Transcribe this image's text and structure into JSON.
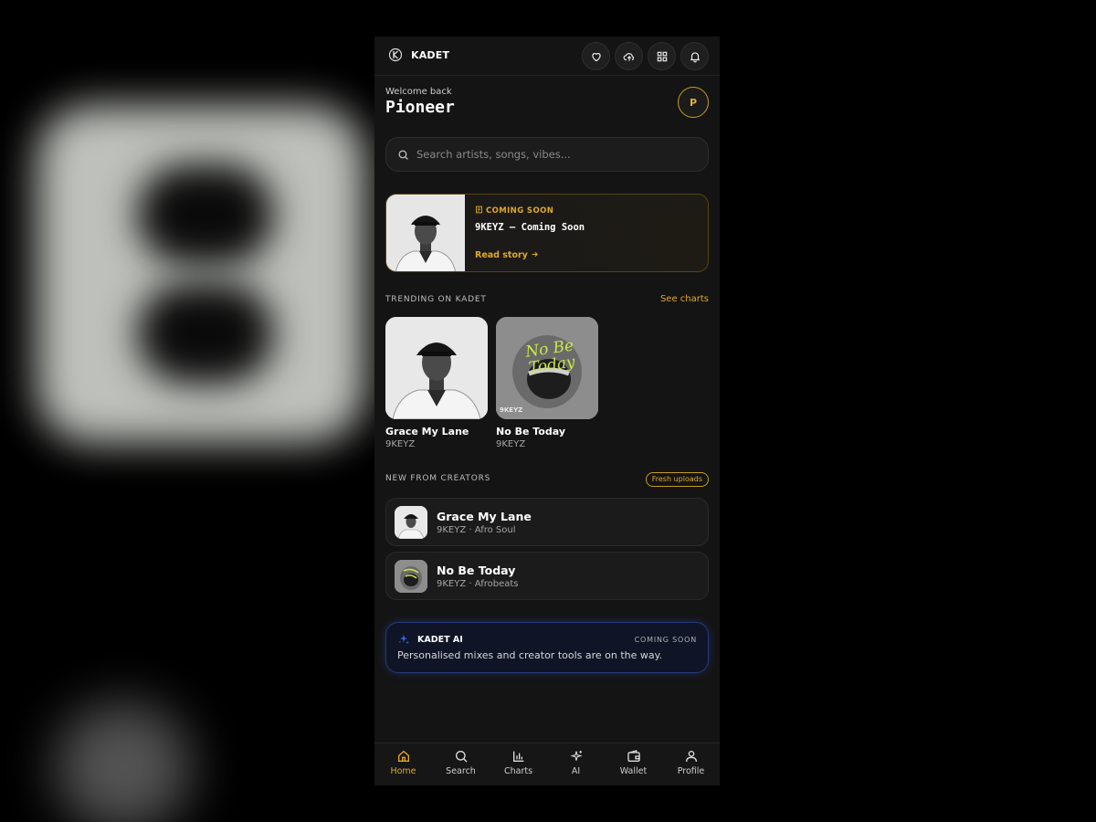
{
  "app": {
    "brand": "KADET"
  },
  "header": {
    "welcome": "Welcome back",
    "username": "Pioneer",
    "avatar_initial": "P"
  },
  "search": {
    "placeholder": "Search artists, songs, vibes..."
  },
  "promo": {
    "tag": "COMING SOON",
    "title": "9KEYZ — Coming Soon",
    "link": "Read story"
  },
  "trending": {
    "title": "TRENDING ON KADET",
    "link": "See charts",
    "items": [
      {
        "title": "Grace My Lane",
        "artist": "9KEYZ"
      },
      {
        "title": "No Be Today",
        "artist": "9KEYZ",
        "art_text": "No Be Today",
        "art_label": "9KEYZ"
      }
    ]
  },
  "creators": {
    "title": "NEW FROM CREATORS",
    "chip": "Fresh uploads",
    "items": [
      {
        "title": "Grace My Lane",
        "meta": "9KEYZ · Afro Soul"
      },
      {
        "title": "No Be Today",
        "meta": "9KEYZ · Afrobeats"
      }
    ]
  },
  "ai": {
    "label": "KADET AI",
    "status": "COMING SOON",
    "description": "Personalised mixes and creator tools are on the way."
  },
  "nav": {
    "items": [
      {
        "label": "Home",
        "icon": "home-icon",
        "active": true
      },
      {
        "label": "Search",
        "icon": "search-icon"
      },
      {
        "label": "Charts",
        "icon": "bar-chart-icon"
      },
      {
        "label": "AI",
        "icon": "sparkles-icon"
      },
      {
        "label": "Wallet",
        "icon": "wallet-icon"
      },
      {
        "label": "Profile",
        "icon": "user-icon"
      }
    ]
  },
  "colors": {
    "accent": "#e0a92a",
    "background": "#141414",
    "ai_accent": "#263a7a"
  }
}
